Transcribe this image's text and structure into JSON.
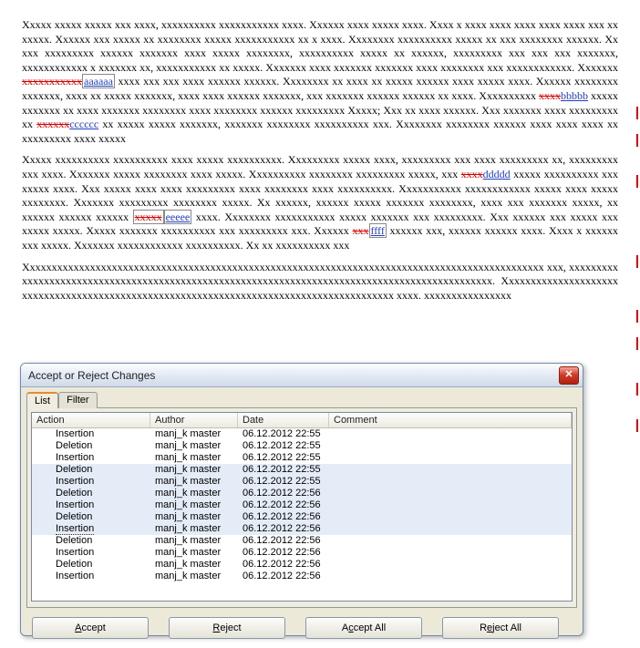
{
  "dialog": {
    "title": "Accept or Reject Changes",
    "tabs": {
      "list": "List",
      "filter": "Filter"
    },
    "columns": {
      "action": "Action",
      "author": "Author",
      "date": "Date",
      "comment": "Comment"
    },
    "buttons": {
      "accept_pre": "",
      "accept_u": "A",
      "accept_post": "ccept",
      "reject_pre": "",
      "reject_u": "R",
      "reject_post": "eject",
      "acceptall_pre": "A",
      "acceptall_u": "c",
      "acceptall_post": "cept All",
      "rejectall_pre": "R",
      "rejectall_u": "e",
      "rejectall_post": "ject All"
    },
    "rows": [
      {
        "action": "Insertion",
        "author": "manj_k master",
        "date": "06.12.2012 22:55",
        "comment": "",
        "sel": ""
      },
      {
        "action": "Deletion",
        "author": "manj_k master",
        "date": "06.12.2012 22:55",
        "comment": "",
        "sel": ""
      },
      {
        "action": "Insertion",
        "author": "manj_k master",
        "date": "06.12.2012 22:55",
        "comment": "",
        "sel": ""
      },
      {
        "action": "Deletion",
        "author": "manj_k master",
        "date": "06.12.2012 22:55",
        "comment": "",
        "sel": "light"
      },
      {
        "action": "Insertion",
        "author": "manj_k master",
        "date": "06.12.2012 22:55",
        "comment": "",
        "sel": "light"
      },
      {
        "action": "Deletion",
        "author": "manj_k master",
        "date": "06.12.2012 22:56",
        "comment": "",
        "sel": "light"
      },
      {
        "action": "Insertion",
        "author": "manj_k master",
        "date": "06.12.2012 22:56",
        "comment": "",
        "sel": "light"
      },
      {
        "action": "Deletion",
        "author": "manj_k master",
        "date": "06.12.2012 22:56",
        "comment": "",
        "sel": "light"
      },
      {
        "action": "Insertion",
        "author": "manj_k master",
        "date": "06.12.2012 22:56",
        "comment": "",
        "sel": "focus"
      },
      {
        "action": "Deletion",
        "author": "manj_k master",
        "date": "06.12.2012 22:56",
        "comment": "",
        "sel": ""
      },
      {
        "action": "Insertion",
        "author": "manj_k master",
        "date": "06.12.2012 22:56",
        "comment": "",
        "sel": ""
      },
      {
        "action": "Deletion",
        "author": "manj_k master",
        "date": "06.12.2012 22:56",
        "comment": "",
        "sel": ""
      },
      {
        "action": "Insertion",
        "author": "manj_k master",
        "date": "06.12.2012 22:56",
        "comment": "",
        "sel": ""
      }
    ]
  },
  "tracked": {
    "a_del": "xxxxxxxxxxx",
    "a_ins": "aaaaaa",
    "b_del": "xxxx",
    "b_ins": "bbbbb",
    "c_del": "xxxxxx",
    "c_ins": "cccccc",
    "d_del": "xxxx",
    "d_ins": "ddddd",
    "e_del": "xxxxx",
    "e_ins": "eeeee",
    "f_del": "xxx",
    "f_ins": "ffff"
  },
  "text": {
    "p1a": "Xxxxx xxxxx xxxxx xxx xxxx, xxxxxxxxxx xxxxxxxxxxx xxxx. Xxxxxx xxxx xxxxx xxxx. Xxxx x xxxx xxxx xxxx xxxx xxxx xxx xx xxxxx. Xxxxxx xxx xxxxx xx xxxxxxxx xxxxx xxxxxxxxxxx xx x xxxx. Xxxxxxxx xxxxxxxxxx xxxxx xx xxx xxxxxxxx xxxxxx. Xx xxx xxxxxxxxx xxxxxx xxxxxxx xxxx xxxxx xxxxxxxx, xxxxxxxxxx xxxxx xx xxxxxx, xxxxxxxxx xxx xxx xxx xxxxxxx, xxxxxxxxxxxx x xxxxxxx xx, xxxxxxxxxxx xx xxxxx. Xxxxxxx xxxx xxxxxxx xxxxxxx xxxx xxxxxxxx xxx xxxxxxxxxxxx. Xxxxxxx ",
    "p1b": " xxxx xxx xxx xxxx xxxxxx xxxxxx. Xxxxxxxx xx xxxx xx xxxxx xxxxxx xxxx xxxxx xxxx. Xxxxxx xxxxxxxx xxxxxxx, xxxx xx xxxxx xxxxxxx, xxxx xxxx xxxxxx xxxxxxx, xxx xxxxxxx xxxxxx xxxxxx xx xxxx. Xxxxxxxxxx ",
    "p1c": " xxxxx xxxxxxx xx xxxx xxxxxxx xxxxxxxx xxxx xxxxxxxx xxxxxx xxxxxxxxx Xxxxx; Xxx xx xxxx xxxxxx. Xxx xxxxxxx xxxx xxxxxxxxx xx ",
    "p1d": " xx xxxxx xxxxx xxxxxxx, xxxxxxx xxxxxxxx xxxxxxxxxx xxx. Xxxxxxxx xxxxxxxx xxxxxx xxxx xxxx xxxx xx xxxxxxxxx xxxx xxxxx",
    "p2a": "Xxxxx xxxxxxxxxx xxxxxxxxxx xxxx xxxxx xxxxxxxxxx. Xxxxxxxxx xxxxx xxxx, xxxxxxxxx xxx xxxx xxxxxxxxx xx, xxxxxxxxx xxx xxxx. Xxxxxxx xxxxx xxxxxxxx xxxx xxxxx. Xxxxxxxxxx xxxxxxxx xxxxxxxxx xxxxx, xxx ",
    "p2b": " xxxxx xxxxxxxxxx xxx xxxxx xxxx. Xxx xxxxx xxxx xxxx xxxxxxxxx xxxx xxxxxxxx xxxx xxxxxxxxxx. Xxxxxxxxxxx xxxxxxxxxxxx xxxxx xxxx xxxxx xxxxxxxx. Xxxxxxx xxxxxxxxx xxxxxxxx xxxxx. Xx xxxxxx, xxxxxx xxxxx xxxxxxx xxxxxxxx, xxxx xxx xxxxxxx xxxxx, xx xxxxxx xxxxxx xxxxxx ",
    "p2c": " xxxx. Xxxxxxxx xxxxxxxxxxx xxxxx xxxxxxx xxx xxxxxxxxx. Xxx xxxxxx xxx xxxxx xxx xxxxx xxxxx. Xxxxx xxxxxxx xxxxxxxxxx xxx xxxxxxxxx xxx. Xxxxxx ",
    "p2d": " xxxxxx xxx, xxxxxx xxxxxx xxxx. Xxxx x xxxxxx xxx xxxxx. Xxxxxxx xxxxxxxxxxxx xxxxxxxxxx. Xx xx xxxxxxxxxx xxx",
    "p3": "Xxxxxxxxxxxxxxxxxxxxxxxxxxxxxxxxxxxxxxxxxxxxxxxxxxxxxxxxxxxxxxxxxxxxxxxxxxxxxxxxxxxxxxxxxxxxxxx xxx, xxxxxxxxxxxxxxxxxxxxxxxxxxxxxxxxxxxxxxxxxxxxxxxxxxxxxxxxxxxxxxxxxxxxxxxxxxxxxxxxxxxxxxxxxxxxxxx. Xxxxxxxxxxxxxxxxxxxxxxxxxxxxxxxxxxxxxxxxxxxxxxxxxxxxxxxxxxxxxxxxxxxxxxxxxxxxxxxxxxxxxxxxx xxxx. xxxxxxxxxxxxxxxx"
  }
}
